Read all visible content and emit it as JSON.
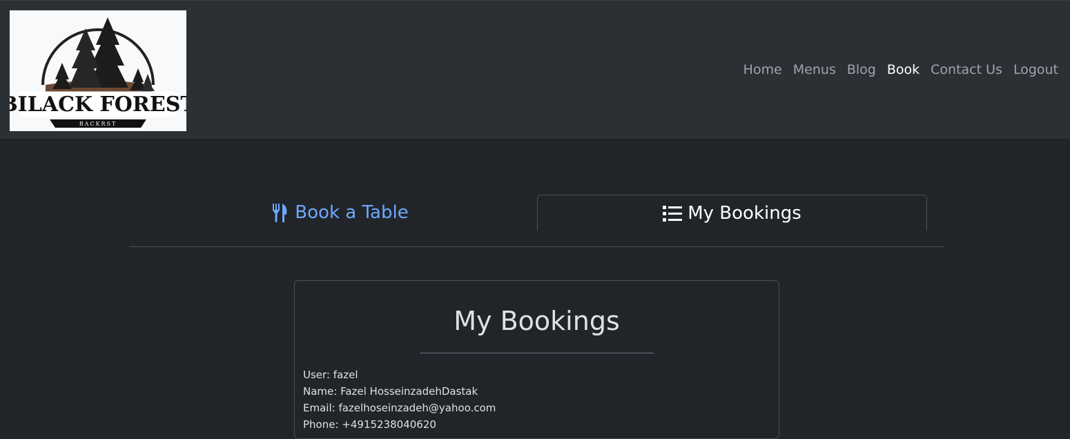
{
  "logo": {
    "title": "BILACK FOREST",
    "subtitle": "BACKRST"
  },
  "nav": {
    "items": [
      {
        "label": "Home"
      },
      {
        "label": "Menus"
      },
      {
        "label": "Blog"
      },
      {
        "label": "Book"
      },
      {
        "label": "Contact Us"
      },
      {
        "label": "Logout"
      }
    ]
  },
  "tabs": {
    "book_label": "Book a Table",
    "bookings_label": "My Bookings",
    "book_icon": "utensils-icon",
    "bookings_icon": "list-icon"
  },
  "card": {
    "title": "My Bookings",
    "user": "User: fazel",
    "name": "Name: Fazel HosseinzadehDastak",
    "email": "Email: fazelhoseinzadeh@yahoo.com",
    "phone": "Phone: +4915238040620"
  },
  "colors": {
    "accent": "#6ea8fe",
    "navbar": "#2b3035",
    "background": "#212529"
  }
}
